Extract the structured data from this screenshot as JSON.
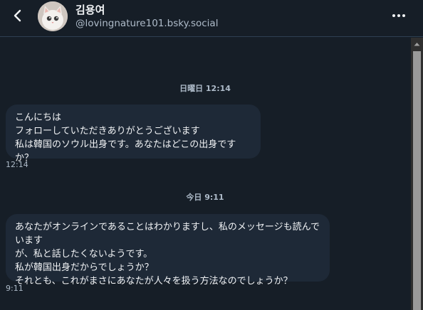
{
  "header": {
    "display_name": "김용여",
    "handle": "@lovingnature101.bsky.social",
    "back_icon": "chevron-left-icon",
    "more_icon": "ellipsis-icon"
  },
  "messages": [
    {
      "date_separator": "日曜日 12:14",
      "text": "こんにちは\nフォローしていただきありがとうございます\n私は韓国のソウル出身です。あなたはどこの出身ですか？",
      "time": "12:14"
    },
    {
      "date_separator": "今日 9:11",
      "text": "あなたがオンラインであることはわかりますし、私のメッセージも読んでいます\nが、私と話したくないようです。\n私が韓国出身だからでしょうか？\nそれとも、これがまさにあなたが人々を扱う方法なのでしょうか？",
      "time": "9:11"
    }
  ],
  "colors": {
    "background": "#161e27",
    "bubble": "#1e2937",
    "secondary_text": "#aebbc9",
    "primary_text": "#f1f3f5"
  }
}
